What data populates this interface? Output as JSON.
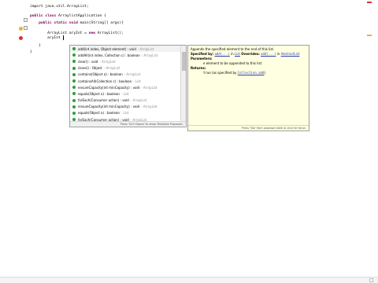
{
  "editor": {
    "lines": [
      {
        "parts": [
          {
            "t": "import java.util.ArrayList;",
            "k": false
          }
        ]
      },
      {
        "parts": [
          {
            "t": "",
            "k": false
          }
        ]
      },
      {
        "parts": [
          {
            "t": "public class ",
            "k": true
          },
          {
            "t": "ArraylistApplication {",
            "k": false
          }
        ]
      },
      {
        "parts": [
          {
            "t": "    public static void ",
            "k": true
          },
          {
            "t": "main(String[] args){",
            "k": false
          }
        ]
      },
      {
        "parts": [
          {
            "t": "",
            "k": false
          }
        ]
      },
      {
        "parts": [
          {
            "t": "        ArrayList aryInt = ",
            "k": false
          },
          {
            "t": "new ",
            "k": true
          },
          {
            "t": "ArrayList();",
            "k": false
          }
        ]
      },
      {
        "parts": [
          {
            "t": "        aryInt ",
            "k": false
          }
        ]
      },
      {
        "parts": [
          {
            "t": "    }",
            "k": false
          }
        ]
      },
      {
        "parts": [
          {
            "t": "}",
            "k": false
          }
        ]
      }
    ]
  },
  "assist": {
    "items": [
      {
        "signature": "add(int index, Object element) : void",
        "type": "- ArrayList"
      },
      {
        "signature": "addAll(int index, Collection c) : boolean",
        "type": "- ArrayList"
      },
      {
        "signature": "clear() : void",
        "type": "- ArrayList"
      },
      {
        "signature": "clone() : Object",
        "type": "- ArrayList"
      },
      {
        "signature": "contains(Object o) : boolean",
        "type": "- ArrayList"
      },
      {
        "signature": "containsAll(Collection c) : boolean",
        "type": "- List"
      },
      {
        "signature": "ensureCapacity(int minCapacity) : void",
        "type": "- ArrayList"
      },
      {
        "signature": "equals(Object o) : boolean",
        "type": "- List"
      },
      {
        "signature": "forEach(Consumer action) : void",
        "type": "- ArrayList"
      },
      {
        "signature": "ensureCapacity(int minCapacity) : void",
        "type": "- ArrayList"
      },
      {
        "signature": "equals(Object o) : boolean",
        "type": "- List"
      },
      {
        "signature": "forEach(Consumer action) : void",
        "type": "- ArrayList"
      }
    ],
    "footer": "Press 'Ctrl+Space' to show Template Proposals"
  },
  "doc": {
    "summary": "Appends the specified element to the end of this list.",
    "specified_by_label": "Specified by:",
    "specified_by_method": "add(...)",
    "in_label": "in",
    "specified_by_iface": "List",
    "overrides_label": "Overrides:",
    "overrides_method": "add(...)",
    "overrides_class": "AbstractList",
    "parameters_label": "Parameters:",
    "param_name": "e",
    "param_desc": "element to be appended to this list",
    "returns_label": "Returns:",
    "returns_value": "true",
    "returns_desc": "(as specified by",
    "returns_link": "Collection.add",
    "returns_end": ")",
    "footer": "Press 'Tab' from proposal table or click for focus"
  },
  "colors": {
    "keyword": "#7f0055",
    "method_icon": "#2f9e3f",
    "doc_background": "#ffffe1",
    "error_marker": "#d9342b",
    "warning_marker": "#e8b13a"
  }
}
